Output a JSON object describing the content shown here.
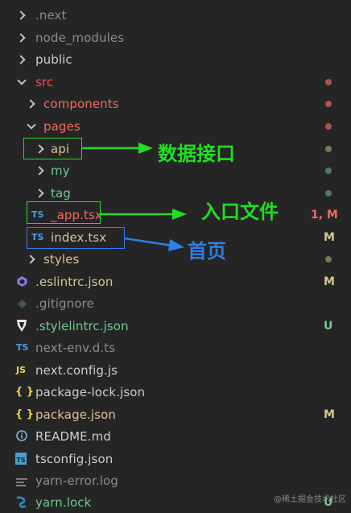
{
  "colors": {
    "background": "#252526",
    "default_text": "#cccccc",
    "ignored_text": "#8c8c8c",
    "modified": "#e2c08d",
    "untracked": "#73c991",
    "error": "#f14c4c",
    "annotation_green": "#22dd22",
    "annotation_blue": "#2d7fe8"
  },
  "tree": [
    {
      "label": ".next",
      "chevron": "right",
      "icon": "",
      "badge": "",
      "dot": ""
    },
    {
      "label": "node_modules",
      "chevron": "right",
      "icon": "",
      "badge": "",
      "dot": ""
    },
    {
      "label": "public",
      "chevron": "right",
      "icon": "",
      "badge": "",
      "dot": ""
    },
    {
      "label": "src",
      "chevron": "down",
      "icon": "",
      "badge": "",
      "dot": "red"
    },
    {
      "label": "components",
      "chevron": "right",
      "icon": "",
      "badge": "",
      "dot": "red"
    },
    {
      "label": "pages",
      "chevron": "down",
      "icon": "",
      "badge": "",
      "dot": "red"
    },
    {
      "label": "api",
      "chevron": "right",
      "icon": "",
      "badge": "",
      "dot": "olive"
    },
    {
      "label": "my",
      "chevron": "right",
      "icon": "",
      "badge": "",
      "dot": "green"
    },
    {
      "label": "tag",
      "chevron": "right",
      "icon": "",
      "badge": "",
      "dot": "green"
    },
    {
      "label": "_app.tsx",
      "chevron": "",
      "icon": "TS",
      "badge": "1, M",
      "dot": ""
    },
    {
      "label": "index.tsx",
      "chevron": "",
      "icon": "TS",
      "badge": "M",
      "dot": ""
    },
    {
      "label": "styles",
      "chevron": "right",
      "icon": "",
      "badge": "",
      "dot": "olive"
    },
    {
      "label": ".eslintrc.json",
      "chevron": "",
      "icon": "eslint-icon",
      "badge": "M",
      "dot": ""
    },
    {
      "label": ".gitignore",
      "chevron": "",
      "icon": "git-icon",
      "badge": "",
      "dot": ""
    },
    {
      "label": ".stylelintrc.json",
      "chevron": "",
      "icon": "stylelint-icon",
      "badge": "U",
      "dot": ""
    },
    {
      "label": "next-env.d.ts",
      "chevron": "",
      "icon": "TS",
      "badge": "",
      "dot": ""
    },
    {
      "label": "next.config.js",
      "chevron": "",
      "icon": "JS",
      "badge": "",
      "dot": ""
    },
    {
      "label": "package-lock.json",
      "chevron": "",
      "icon": "{ }",
      "badge": "",
      "dot": ""
    },
    {
      "label": "package.json",
      "chevron": "",
      "icon": "{ }",
      "badge": "M",
      "dot": ""
    },
    {
      "label": "README.md",
      "chevron": "",
      "icon": "info-icon",
      "badge": "",
      "dot": ""
    },
    {
      "label": "tsconfig.json",
      "chevron": "",
      "icon": "TS",
      "badge": "",
      "dot": ""
    },
    {
      "label": "yarn-error.log",
      "chevron": "",
      "icon": "log-icon",
      "badge": "",
      "dot": ""
    },
    {
      "label": "yarn.lock",
      "chevron": "",
      "icon": "yarn-icon",
      "badge": "U",
      "dot": ""
    }
  ],
  "annotations": {
    "api_text": "数据接口",
    "app_text": "入口文件",
    "index_text": "首页"
  },
  "watermark": "@稀土掘金技术社区"
}
